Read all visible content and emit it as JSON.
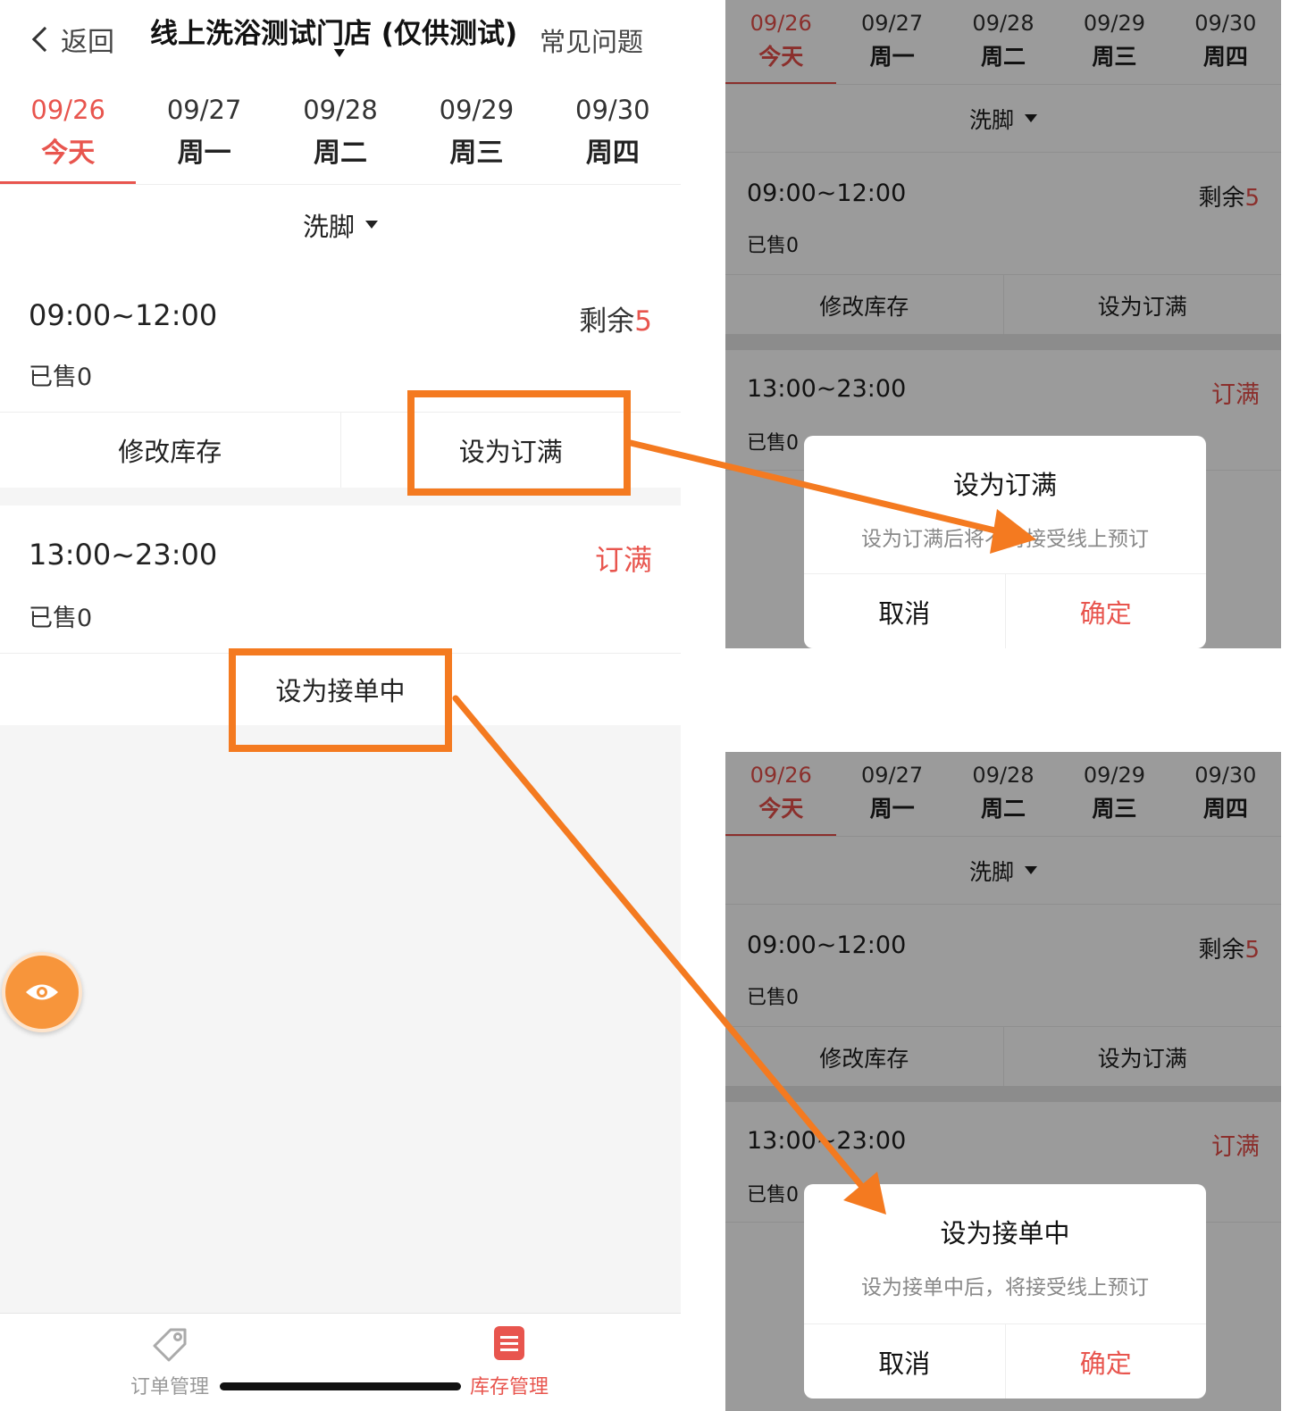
{
  "header": {
    "back_label": "返回",
    "title": "线上洗浴测试门店 (仅供测试)",
    "faq_label": "常见问题"
  },
  "dates": [
    {
      "date": "09/26",
      "weekday": "今天",
      "active": true
    },
    {
      "date": "09/27",
      "weekday": "周一",
      "active": false
    },
    {
      "date": "09/28",
      "weekday": "周二",
      "active": false
    },
    {
      "date": "09/29",
      "weekday": "周三",
      "active": false
    },
    {
      "date": "09/30",
      "weekday": "周四",
      "active": false
    }
  ],
  "service": {
    "label": "洗脚"
  },
  "slots": [
    {
      "time": "09:00~12:00",
      "sold": "已售0",
      "remain_label": "剩余",
      "remain_count": "5",
      "actions": [
        "修改库存",
        "设为订满"
      ]
    },
    {
      "time": "13:00~23:00",
      "sold": "已售0",
      "status": "订满",
      "actions": [
        "设为接单中"
      ]
    }
  ],
  "tabbar": {
    "order_label": "订单管理",
    "stock_label": "库存管理"
  },
  "modal_full": {
    "title": "设为订满",
    "desc": "设为订满后将不再接受线上预订",
    "cancel": "取消",
    "confirm": "确定"
  },
  "modal_accept": {
    "title": "设为接单中",
    "desc": "设为接单中后，将接受线上预订",
    "cancel": "取消",
    "confirm": "确定"
  },
  "colors": {
    "accent": "#e8554e",
    "annotation": "#f47a20",
    "fab": "#f7953b",
    "overlay_bg": "#9b9b9b"
  },
  "icons": {
    "back": "chevron-left-icon",
    "fab": "eye-icon",
    "order_tab": "tag-icon",
    "stock_tab": "list-doc-icon"
  }
}
